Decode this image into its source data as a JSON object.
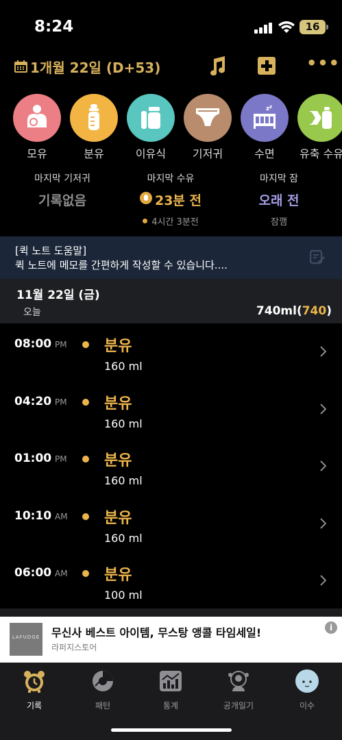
{
  "status": {
    "time": "8:24",
    "battery": "16"
  },
  "header": {
    "date": "1개월 22일 (D+53)",
    "accent": "#d8b15d"
  },
  "categories": [
    {
      "label": "모유",
      "color": "#ec7f85",
      "icon": "breastfeed-icon"
    },
    {
      "label": "분유",
      "color": "#f2b544",
      "icon": "bottle-icon"
    },
    {
      "label": "이유식",
      "color": "#59c6c0",
      "icon": "baby-food-icon"
    },
    {
      "label": "기저귀",
      "color": "#b88c6c",
      "icon": "diaper-icon"
    },
    {
      "label": "수면",
      "color": "#7c78c8",
      "icon": "crib-icon"
    },
    {
      "label": "유축 수유",
      "color": "#98c84c",
      "icon": "pump-bottle-icon"
    }
  ],
  "last": {
    "diaper": {
      "title": "마지막 기저귀",
      "value": "기록없음"
    },
    "feeding": {
      "title": "마지막 수유",
      "value": "23분 전",
      "sub": "4시간 3분전"
    },
    "sleep": {
      "title": "마지막 잠",
      "value": "오래 전",
      "sub": "잠깸"
    }
  },
  "note": {
    "title": "[퀵 노트 도움말]",
    "body": "퀵 노트에 메모를 간편하게 작성할 수 있습니다...."
  },
  "day": {
    "date": "11월 22일 (금)",
    "today": "오늘",
    "total": "740ml",
    "total_paren_open": "(",
    "total_count": "740",
    "total_paren_close": ")"
  },
  "records": [
    {
      "time": "08:00",
      "ampm": "PM",
      "type": "분유",
      "amount": "160 ml"
    },
    {
      "time": "04:20",
      "ampm": "PM",
      "type": "분유",
      "amount": "160 ml"
    },
    {
      "time": "01:00",
      "ampm": "PM",
      "type": "분유",
      "amount": "160 ml"
    },
    {
      "time": "10:10",
      "ampm": "AM",
      "type": "분유",
      "amount": "160 ml"
    },
    {
      "time": "06:00",
      "ampm": "AM",
      "type": "분유",
      "amount": "100 ml"
    }
  ],
  "ad": {
    "logo_text": "LAFUDGE",
    "title": "무신사 베스트 아이템, 무스탕 앵콜 타임세일!",
    "store": "라퍼지스토어",
    "info": "i"
  },
  "tabs": [
    {
      "label": "기록",
      "icon": "alarm-clock-icon",
      "active": true
    },
    {
      "label": "패턴",
      "icon": "pattern-chart-icon",
      "active": false
    },
    {
      "label": "통계",
      "icon": "stats-chart-icon",
      "active": false
    },
    {
      "label": "공개일기",
      "icon": "public-diary-icon",
      "active": false
    },
    {
      "label": "이수",
      "icon": "baby-avatar-icon",
      "active": false
    }
  ]
}
